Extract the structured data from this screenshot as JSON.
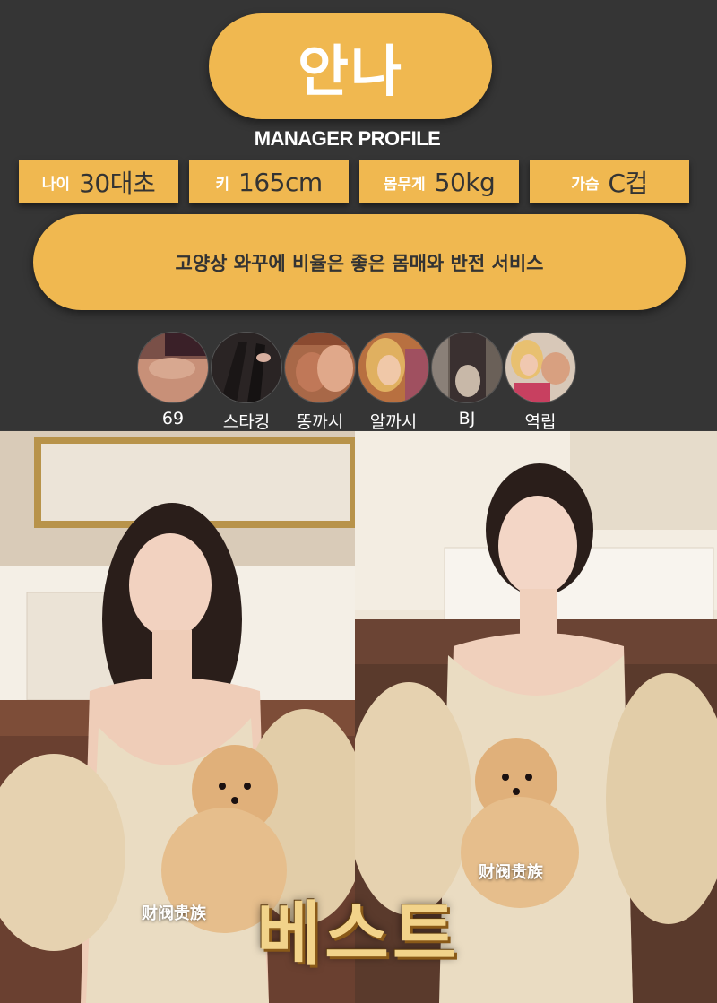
{
  "profile": {
    "name": "안나",
    "subtitle": "MANAGER PROFILE",
    "stats": [
      {
        "label": "나이",
        "value": "30대초"
      },
      {
        "label": "키",
        "value": "165cm"
      },
      {
        "label": "몸무게",
        "value": "50kg"
      },
      {
        "label": "가슴",
        "value": "C컵"
      }
    ],
    "description": "고양상 와꾸에 비율은 좋은 몸매와 반전 서비스"
  },
  "services": [
    {
      "label": "69",
      "icon": "service-photo-69"
    },
    {
      "label": "스타킹",
      "icon": "service-photo-stockings"
    },
    {
      "label": "똥까시",
      "icon": "service-photo"
    },
    {
      "label": "알까시",
      "icon": "service-photo"
    },
    {
      "label": "BJ",
      "icon": "service-photo"
    },
    {
      "label": "역립",
      "icon": "service-photo"
    }
  ],
  "photos": {
    "left_watermark": "财阀贵族",
    "right_watermark": "财阀贵族",
    "badge": "베스트"
  },
  "colors": {
    "accent": "#f0b850",
    "background": "#353535",
    "text_light": "#ffffff",
    "text_dark": "#333333"
  }
}
